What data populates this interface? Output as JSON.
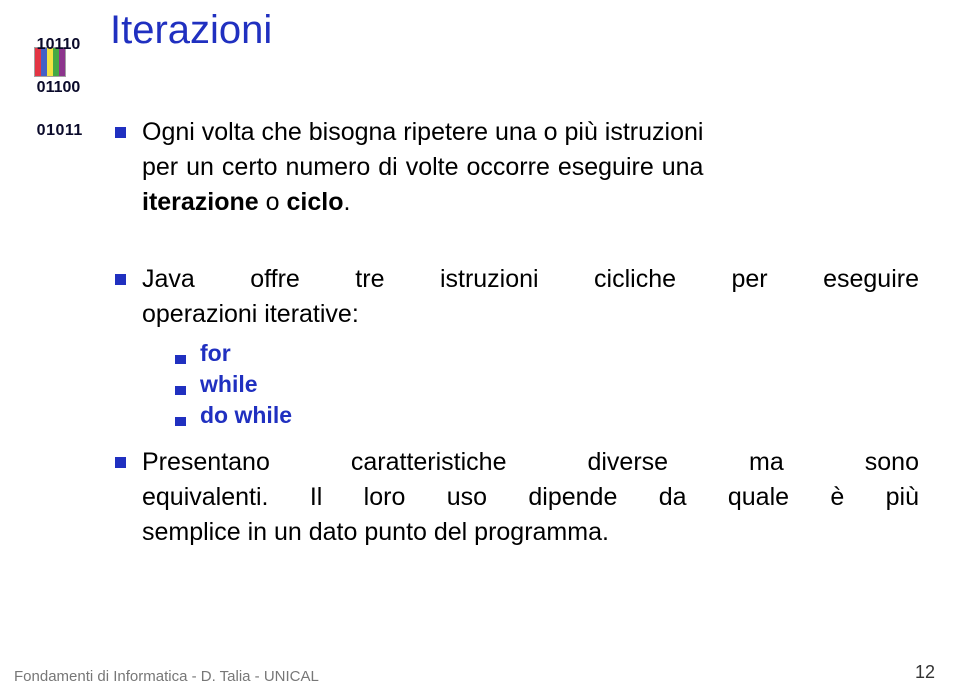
{
  "decoration": {
    "binary": [
      "10110",
      "01100",
      "01011"
    ]
  },
  "title": "Iterazioni",
  "bullets": {
    "b1": {
      "l1": "Ogni volta che bisogna ripetere una o più istruzioni",
      "l2a": "per un certo numero di volte occorre eseguire una",
      "l3a": "iterazione",
      "l3b": " o ",
      "l3c": "ciclo",
      "l3d": "."
    },
    "b2": {
      "l1a": "Java",
      "l1b": "offre",
      "l1c": "tre",
      "l1d": "istruzioni",
      "l1e": "cicliche",
      "l1f": "per",
      "l1g": "eseguire",
      "l2": "operazioni iterative:"
    },
    "inner": {
      "i1": "for",
      "i2": "while",
      "i3": "do while"
    },
    "b3": {
      "l1a": "Presentano",
      "l1b": "caratteristiche",
      "l1c": "diverse",
      "l1d": "ma",
      "l1e": "sono",
      "l2": "equivalenti. Il loro uso dipende da quale è più",
      "l3": "semplice in un dato punto del programma."
    }
  },
  "footer": "Fondamenti di Informatica - D. Talia - UNICAL",
  "page": "12"
}
